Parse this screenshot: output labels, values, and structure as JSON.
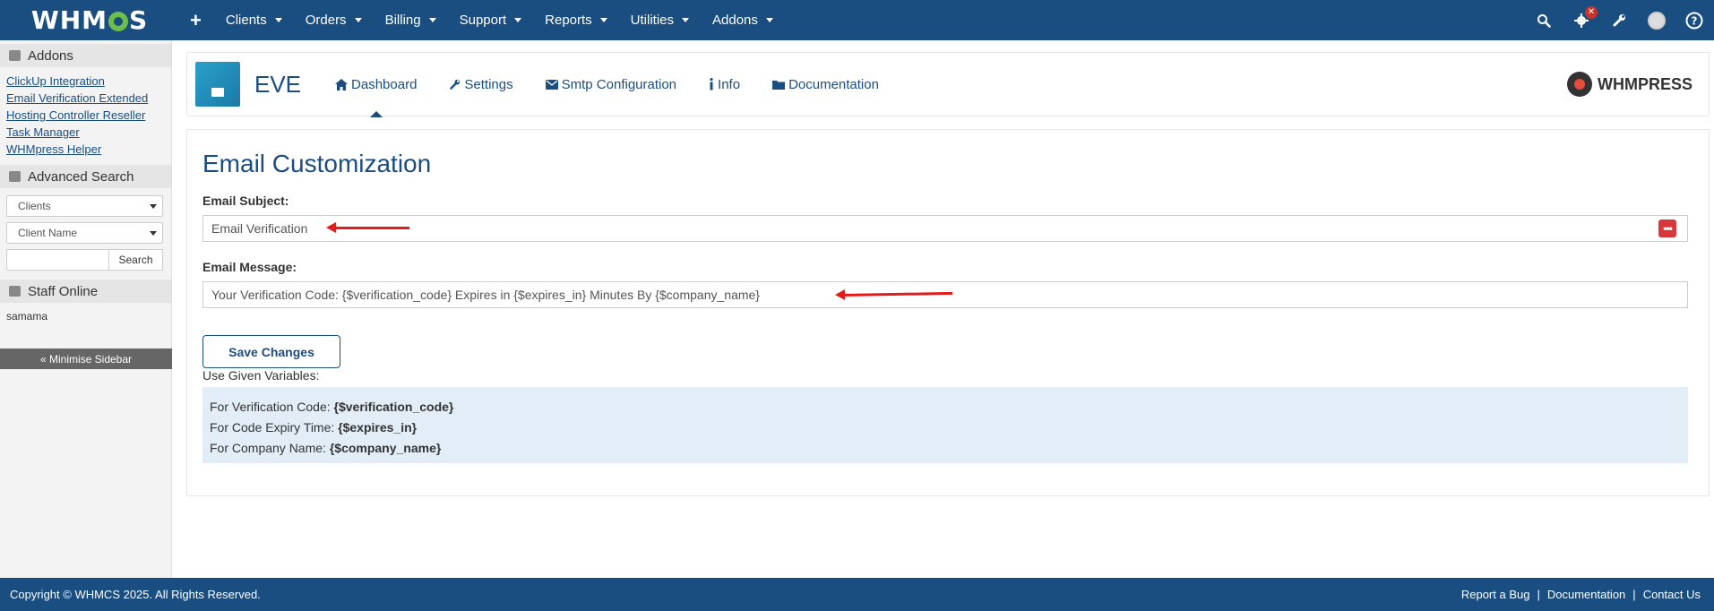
{
  "topnav": {
    "logo": "WHMCS",
    "plus": "+",
    "items": [
      {
        "label": "Clients"
      },
      {
        "label": "Orders"
      },
      {
        "label": "Billing"
      },
      {
        "label": "Support"
      },
      {
        "label": "Reports"
      },
      {
        "label": "Utilities"
      },
      {
        "label": "Addons"
      }
    ],
    "icons": [
      "search-icon",
      "gear-icon",
      "wrench-icon",
      "avatar",
      "help-icon"
    ],
    "badge": "✕"
  },
  "sidebar": {
    "addons_title": "Addons",
    "addons_links": [
      {
        "label": "ClickUp Integration"
      },
      {
        "label": "Email Verification Extended"
      },
      {
        "label": "Hosting Controller Reseller"
      },
      {
        "label": "Task Manager"
      },
      {
        "label": "WHMpress Helper"
      }
    ],
    "advanced_search_title": "Advanced Search",
    "search_type": "Clients",
    "search_field": "Client Name",
    "search_button": "Search",
    "staff_title": "Staff Online",
    "staff_member": "samama",
    "minimise": "« Minimise Sidebar"
  },
  "module": {
    "name": "EVE",
    "tabs": [
      {
        "label": "Dashboard",
        "icon": "home-icon"
      },
      {
        "label": "Settings",
        "icon": "wrench-icon"
      },
      {
        "label": "Smtp Configuration",
        "icon": "envelope-icon"
      },
      {
        "label": "Info",
        "icon": "info-icon"
      },
      {
        "label": "Documentation",
        "icon": "folder-icon"
      }
    ],
    "brand": "WHMPRESS"
  },
  "form": {
    "title": "Email Customization",
    "subject_label": "Email Subject:",
    "subject_value": "Email Verification",
    "message_label": "Email Message:",
    "message_value": "Your Verification Code: {$verification_code} Expires in {$expires_in} Minutes By {$company_name}",
    "save_button": "Save Changes",
    "use_given": "Use Given Variables:",
    "variables": [
      {
        "label": "For Verification Code: ",
        "var": "{$verification_code}"
      },
      {
        "label": "For Code Expiry Time: ",
        "var": "{$expires_in}"
      },
      {
        "label": "For Company Name: ",
        "var": "{$company_name}"
      }
    ]
  },
  "footer": {
    "copyright": "Copyright © WHMCS 2025. All Rights Reserved.",
    "links": [
      {
        "label": "Report a Bug"
      },
      {
        "label": "Documentation"
      },
      {
        "label": "Contact Us"
      }
    ],
    "separator": "|"
  },
  "colors": {
    "brand": "#1a4d80",
    "arrow": "#e31b1b",
    "variables_bg": "#e3edf7"
  }
}
